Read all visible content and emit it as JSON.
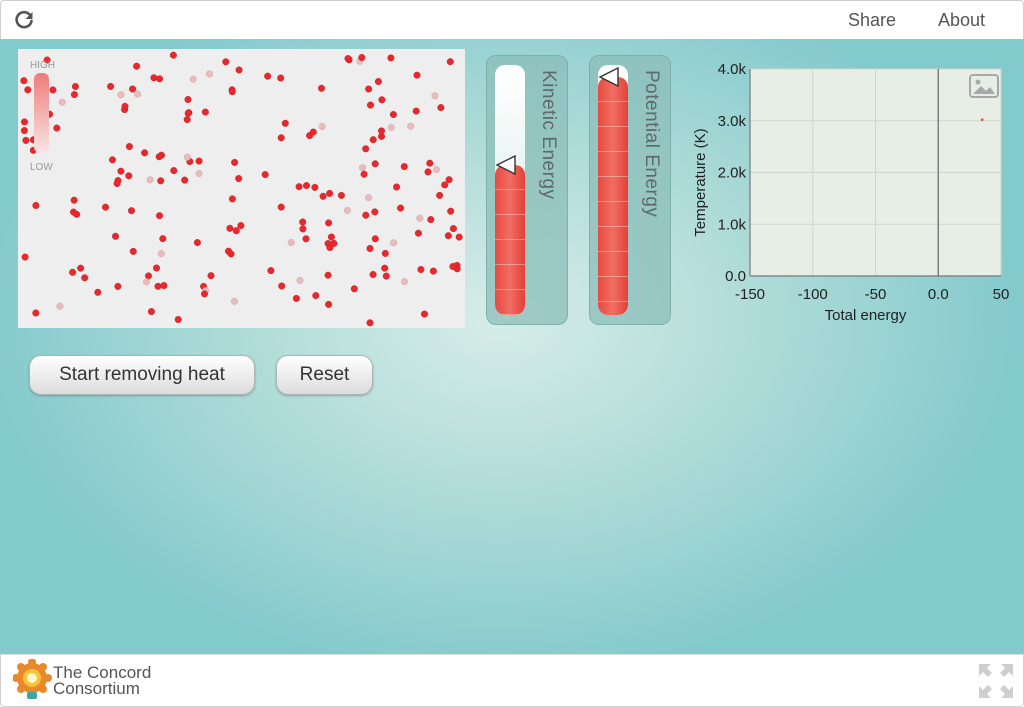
{
  "header": {
    "share_label": "Share",
    "about_label": "About"
  },
  "thermometer": {
    "high_label": "HIGH",
    "low_label": "LOW"
  },
  "gauges": {
    "kinetic": {
      "title": "Kinetic Energy",
      "level": 0.6
    },
    "potential": {
      "title": "Potential Energy",
      "level": 0.95
    }
  },
  "controls": {
    "start_label": "Start removing heat",
    "reset_label": "Reset"
  },
  "chart_data": {
    "type": "scatter",
    "xlabel": "Total energy",
    "ylabel": "Temperature (K)",
    "xlim": [
      -150,
      50
    ],
    "ylim": [
      0,
      4000
    ],
    "x_ticks": [
      "-150",
      "-100",
      "-50",
      "0.0",
      "50"
    ],
    "y_ticks": [
      "4.0k",
      "3.0k",
      "2.0k",
      "1.0k",
      "0.0"
    ],
    "points": [
      {
        "x": 35,
        "y": 3020
      }
    ],
    "point_color": "#e05050",
    "grid": true,
    "plot_background": "#e6eee6"
  },
  "footer": {
    "brand_line1": "The Concord",
    "brand_line2": "Consortium"
  }
}
